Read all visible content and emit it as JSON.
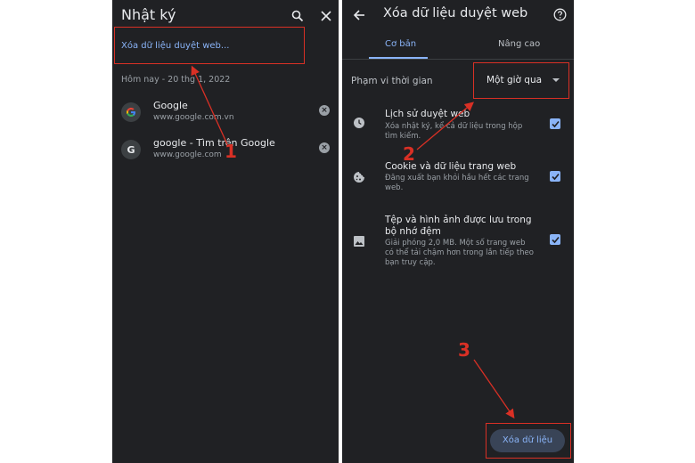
{
  "left_panel": {
    "title": "Nhật ký",
    "search_icon": "search-icon",
    "close_icon": "close-icon",
    "clear_link": "Xóa dữ liệu duyệt web...",
    "date_header": "Hôm nay - 20 thg 1, 2022",
    "items": [
      {
        "title": "Google",
        "url": "www.google.com.vn",
        "favicon": "google-color-icon"
      },
      {
        "title": "google - Tìm trên Google",
        "url": "www.google.com",
        "favicon": "G"
      }
    ]
  },
  "right_panel": {
    "title": "Xóa dữ liệu duyệt web",
    "back_icon": "arrow-back-icon",
    "help_icon": "help-icon",
    "tabs": [
      "Cơ bản",
      "Nâng cao"
    ],
    "active_tab": 0,
    "time_range_label": "Phạm vi thời gian",
    "time_range_value": "Một giờ qua",
    "options": [
      {
        "title": "Lịch sử duyệt web",
        "desc": "Xóa nhật ký, kể cả dữ liệu trong hộp tìm kiếm.",
        "icon": "clock-icon",
        "checked": true
      },
      {
        "title": "Cookie và dữ liệu trang web",
        "desc": "Đăng xuất bạn khỏi hầu hết các trang web.",
        "icon": "cookie-icon",
        "checked": true
      },
      {
        "title": "Tệp và hình ảnh được lưu trong bộ nhớ đệm",
        "desc": "Giải phóng 2,0 MB. Một số trang web có thể tải chậm hơn trong lần tiếp theo bạn truy cập.",
        "icon": "image-icon",
        "checked": true
      }
    ],
    "clear_button": "Xóa dữ liệu"
  },
  "annotations": {
    "labels": [
      "1",
      "2",
      "3"
    ],
    "color": "#d93025"
  },
  "colors": {
    "background": "#202124",
    "accent": "#8ab4f8",
    "text": "#e8eaed",
    "secondary_text": "#9aa0a6"
  }
}
